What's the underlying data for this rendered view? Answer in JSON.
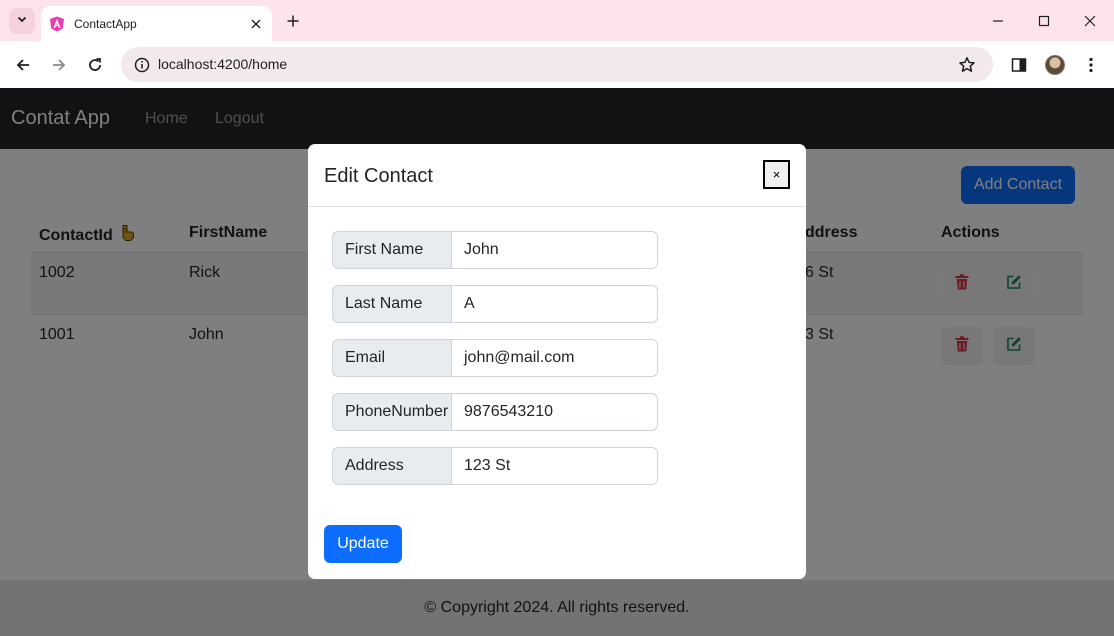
{
  "browser": {
    "tab_title": "ContactApp",
    "url": "localhost:4200/home"
  },
  "navbar": {
    "brand": "Contat App",
    "links": [
      "Home",
      "Logout"
    ]
  },
  "page": {
    "add_button": "Add Contact",
    "table": {
      "headers": [
        "ContactId",
        "FirstName",
        "ddress",
        "Actions"
      ],
      "rows": [
        {
          "id": "1002",
          "first_name": "Rick",
          "address": "6 St"
        },
        {
          "id": "1001",
          "first_name": "John",
          "address": "3 St"
        }
      ]
    },
    "footer": "© Copyright 2024. All rights reserved."
  },
  "modal": {
    "title": "Edit Contact",
    "close_label": "×",
    "fields": [
      {
        "label": "First Name",
        "value": "John"
      },
      {
        "label": "Last Name",
        "value": "A"
      },
      {
        "label": "Email",
        "value": "john@mail.com"
      },
      {
        "label": "PhoneNumber",
        "value": "9876543210"
      },
      {
        "label": "Address",
        "value": "123 St"
      }
    ],
    "submit_label": "Update"
  },
  "colors": {
    "primary": "#0d6efd",
    "navbar": "#212529",
    "delete_icon": "#dc3545",
    "edit_icon": "#198754"
  }
}
